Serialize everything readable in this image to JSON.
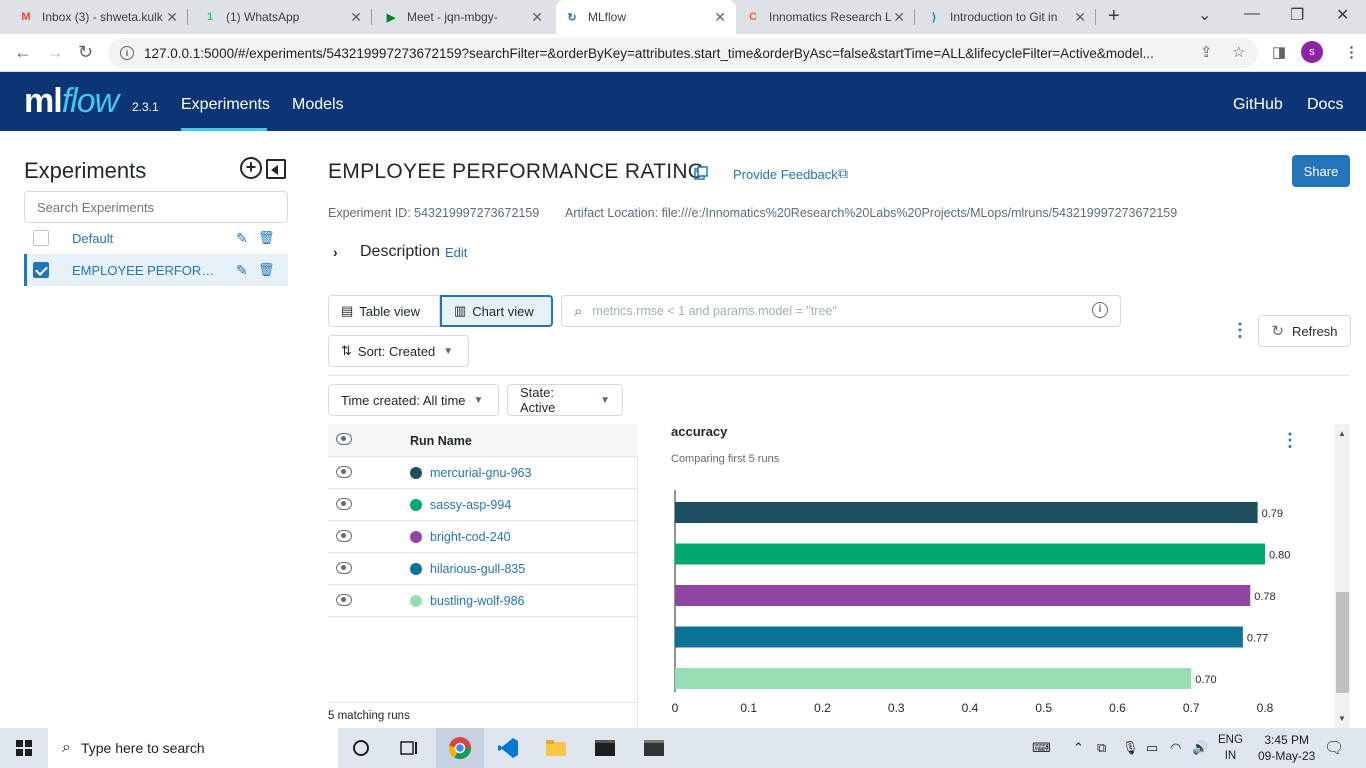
{
  "browser": {
    "tabs": [
      {
        "label": "Inbox (3) - shweta.kulk",
        "icon": "gmail-icon",
        "icon_glyph": "M",
        "icon_color": "#ea4335"
      },
      {
        "label": "(1) WhatsApp",
        "icon": "whatsapp-icon",
        "icon_glyph": "1",
        "icon_color": "#25d366"
      },
      {
        "label": "Meet - jqn-mbgy-",
        "icon": "meet-icon",
        "icon_glyph": "▶",
        "icon_color": "#00832d"
      },
      {
        "label": "MLflow",
        "icon": "mlflow-icon",
        "icon_glyph": "↻",
        "icon_color": "#2374bb"
      },
      {
        "label": "Innomatics Research L",
        "icon": "innomatics-icon",
        "icon_glyph": "C",
        "icon_color": "#f26522"
      },
      {
        "label": "Introduction to Git in",
        "icon": "vscode-icon",
        "icon_glyph": "⟩",
        "icon_color": "#007acc"
      }
    ],
    "url": "127.0.0.1:5000/#/experiments/543219997273672159?searchFilter=&orderByKey=attributes.start_time&orderByAsc=false&startTime=ALL&lifecycleFilter=Active&model...",
    "profile_initial": "s"
  },
  "header": {
    "logo_ml": "ml",
    "logo_flow": "flow",
    "version": "2.3.1",
    "nav": [
      "Experiments",
      "Models"
    ],
    "right_links": [
      "GitHub",
      "Docs"
    ]
  },
  "sidebar": {
    "title": "Experiments",
    "search_placeholder": "Search Experiments",
    "experiments": [
      {
        "name": "Default",
        "checked": false
      },
      {
        "name": "EMPLOYEE PERFORMANCE RATING",
        "checked": true
      }
    ]
  },
  "main": {
    "title": "EMPLOYEE PERFORMANCE RATING",
    "feedback": "Provide Feedback",
    "share": "Share",
    "experiment_id_label": "Experiment ID: 543219997273672159",
    "artifact_label": "Artifact Location: file:///e:/Innomatics%20Research%20Labs%20Projects/MLops/mlruns/543219997273672159",
    "description": "Description",
    "description_edit": "Edit",
    "table_view": "Table view",
    "chart_view": "Chart view",
    "search_placeholder": "metrics.rmse < 1 and params.model = \"tree\"",
    "refresh": "Refresh",
    "sort": "Sort: Created",
    "time_created": "Time created: All time",
    "state": "State: Active",
    "matching_runs": "5 matching runs",
    "run_name_header": "Run Name"
  },
  "runs": [
    {
      "name": "mercurial-gnu-963",
      "color": "#1f4e5f"
    },
    {
      "name": "sassy-asp-994",
      "color": "#00a972"
    },
    {
      "name": "bright-cod-240",
      "color": "#8f46a3"
    },
    {
      "name": "hilarious-gull-835",
      "color": "#0b7297"
    },
    {
      "name": "bustling-wolf-986",
      "color": "#99ddb4"
    }
  ],
  "chart": {
    "title": "accuracy",
    "subtitle": "Comparing first 5 runs"
  },
  "chart_data": {
    "type": "bar",
    "orientation": "horizontal",
    "title": "accuracy",
    "subtitle": "Comparing first 5 runs",
    "categories": [
      "mercurial-gnu-963",
      "sassy-asp-994",
      "bright-cod-240",
      "hilarious-gull-835",
      "bustling-wolf-986"
    ],
    "values": [
      0.79,
      0.8,
      0.78,
      0.77,
      0.7
    ],
    "value_labels": [
      "0.79",
      "0.80",
      "0.78",
      "0.77",
      "0.70"
    ],
    "colors": [
      "#1f4e5f",
      "#00a972",
      "#8f46a3",
      "#0b7297",
      "#99ddb4"
    ],
    "xlim": [
      0,
      0.8
    ],
    "xticks": [
      "0",
      "0.1",
      "0.2",
      "0.3",
      "0.4",
      "0.5",
      "0.6",
      "0.7",
      "0.8"
    ],
    "grid": false
  },
  "taskbar": {
    "search_placeholder": "Type here to search",
    "lang_top": "ENG",
    "lang_bottom": "IN",
    "time": "3:45 PM",
    "date": "09-May-23"
  }
}
